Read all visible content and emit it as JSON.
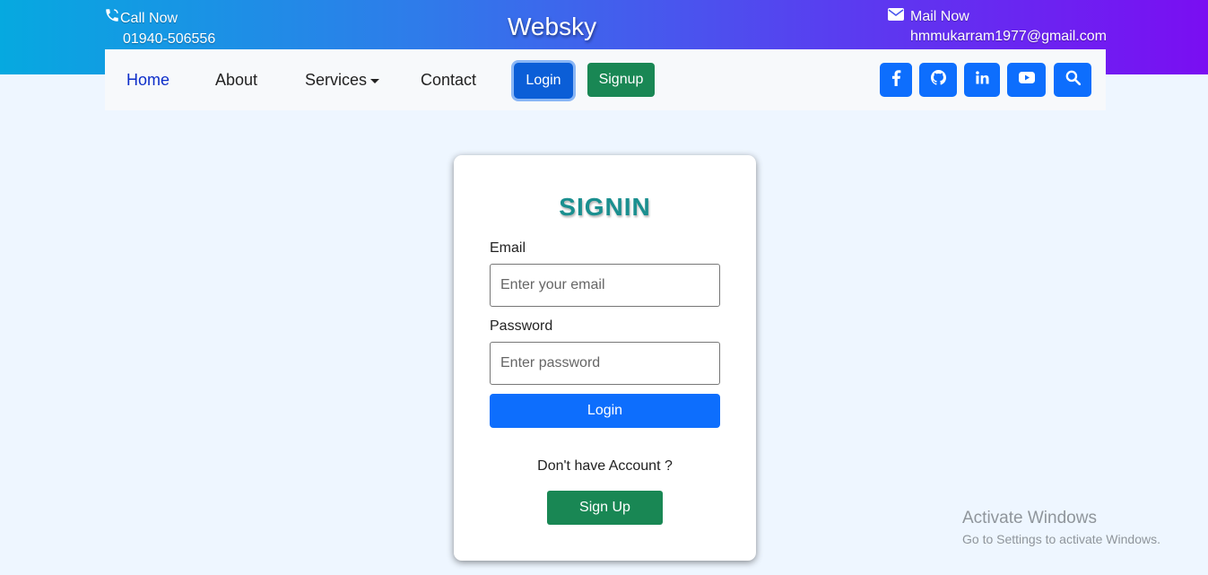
{
  "topbar": {
    "call_label": "Call Now",
    "phone": "01940-506556",
    "brand": "Websky",
    "mail_label": "Mail Now",
    "email": "hmmukarram1977@gmail.com"
  },
  "nav": {
    "home": "Home",
    "about": "About",
    "services": "Services",
    "contact": "Contact",
    "login_button": "Login",
    "signup_button": "Signup",
    "social_icons": [
      "facebook-icon",
      "github-icon",
      "linkedin-icon",
      "youtube-icon",
      "search-icon"
    ]
  },
  "signin": {
    "title": "SIGNIN",
    "email_label": "Email",
    "email_placeholder": "Enter your email",
    "password_label": "Password",
    "password_placeholder": "Enter password",
    "login_button": "Login",
    "no_account_text": "Don't have Account ?",
    "signup_button": "Sign Up"
  },
  "watermark": {
    "title": "Activate Windows",
    "subtitle": "Go to Settings to activate Windows."
  },
  "colors": {
    "gradient_start": "#06a9e0",
    "gradient_end": "#7a0ef2",
    "primary": "#0d6efd",
    "success": "#198754",
    "title": "#1a8f8f",
    "page_bg": "#eef6ff"
  }
}
